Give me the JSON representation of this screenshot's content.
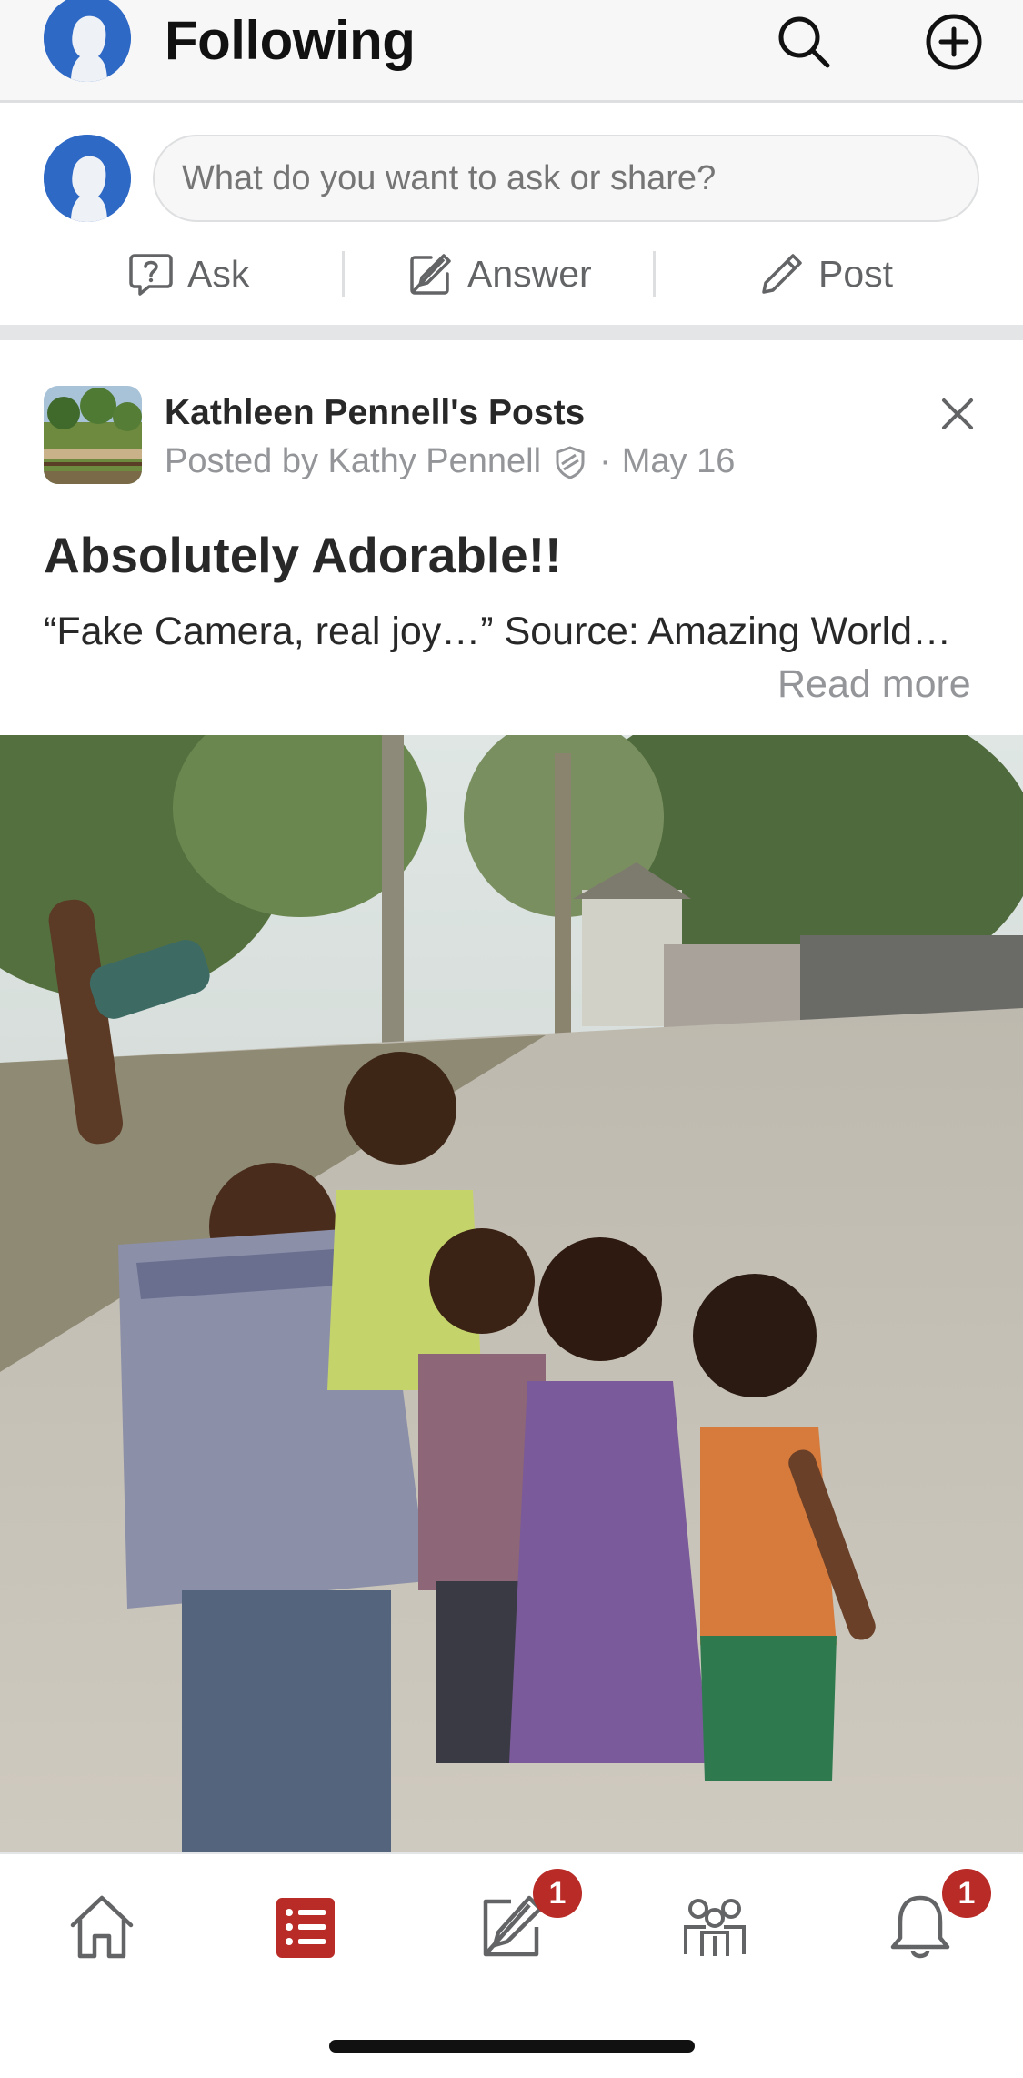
{
  "header": {
    "title": "Following",
    "icons": [
      "user-avatar",
      "search-icon",
      "add-circle-icon"
    ]
  },
  "composer": {
    "placeholder": "What do you want to ask or share?",
    "actions": [
      {
        "label": "Ask",
        "icon": "question-bubble-icon"
      },
      {
        "label": "Answer",
        "icon": "edit-square-icon"
      },
      {
        "label": "Post",
        "icon": "pencil-icon"
      }
    ]
  },
  "post": {
    "space_name": "Kathleen Pennell's Posts",
    "posted_by": "Posted by Kathy Pennell",
    "separator": "·",
    "date": "May 16",
    "title": "Absolutely Adorable!!",
    "excerpt": "“Fake Camera, real joy…” Source: Amazing World…",
    "read_more": "Read more",
    "image_icon": "photo-children-selfie"
  },
  "bottom_nav": {
    "items": [
      {
        "name": "home",
        "icon": "home-icon",
        "active": false
      },
      {
        "name": "following",
        "icon": "list-icon",
        "active": true
      },
      {
        "name": "answer",
        "icon": "edit-icon",
        "badge": "1"
      },
      {
        "name": "spaces",
        "icon": "people-icon",
        "active": false
      },
      {
        "name": "notifications",
        "icon": "bell-icon",
        "badge": "1"
      }
    ]
  },
  "colors": {
    "brand_red": "#b92b27",
    "avatar_blue": "#2e69c6",
    "muted_text": "#939598"
  }
}
